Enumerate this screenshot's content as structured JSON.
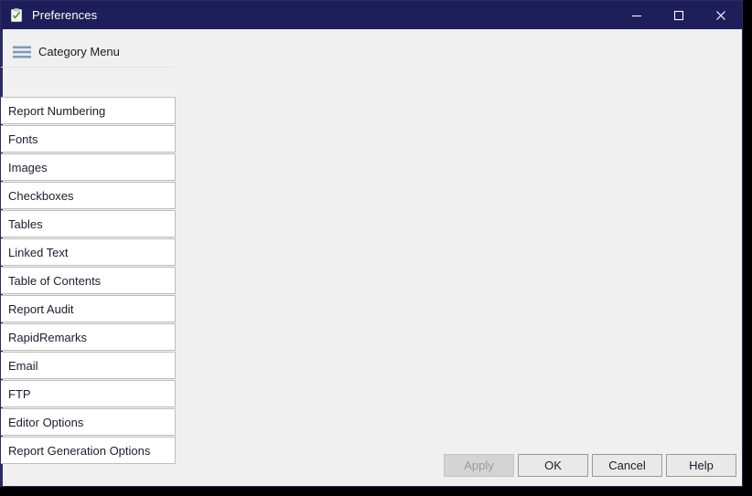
{
  "window": {
    "title": "Preferences",
    "title_icon": "clipboard-check-icon",
    "titlebar_color": "#1e1e5a",
    "background_color": "#f0f0f0",
    "controls": {
      "minimize": "minimize-icon",
      "maximize": "maximize-icon",
      "close": "close-icon"
    }
  },
  "category_menu": {
    "icon": "hamburger-menu-icon",
    "label": "Category Menu",
    "items": [
      {
        "label": "Report Numbering"
      },
      {
        "label": "Fonts"
      },
      {
        "label": "Images"
      },
      {
        "label": "Checkboxes"
      },
      {
        "label": "Tables"
      },
      {
        "label": "Linked Text"
      },
      {
        "label": "Table of Contents"
      },
      {
        "label": "Report Audit"
      },
      {
        "label": "RapidRemarks"
      },
      {
        "label": "Email"
      },
      {
        "label": "FTP"
      },
      {
        "label": "Editor Options"
      },
      {
        "label": "Report Generation Options"
      }
    ]
  },
  "footer": {
    "buttons": [
      {
        "label": "Apply",
        "name": "apply-button",
        "disabled": true
      },
      {
        "label": "OK",
        "name": "ok-button",
        "disabled": false
      },
      {
        "label": "Cancel",
        "name": "cancel-button",
        "disabled": false
      },
      {
        "label": "Help",
        "name": "help-button",
        "disabled": false
      }
    ]
  }
}
